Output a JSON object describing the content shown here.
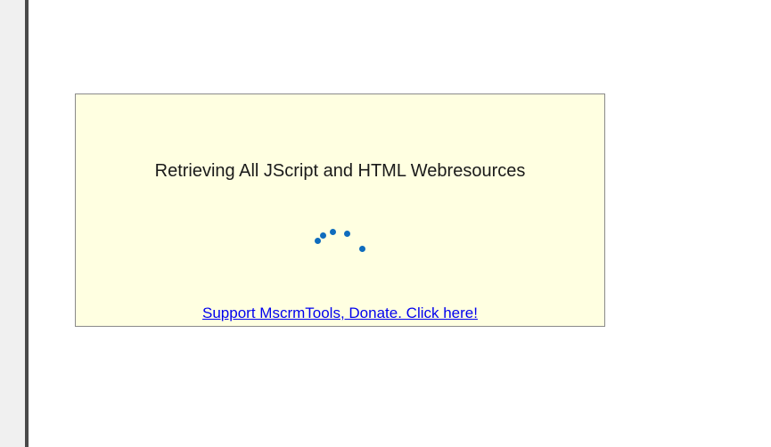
{
  "loading": {
    "message": "Retrieving All JScript and HTML Webresources",
    "link_text": "Support MscrmTools, Donate. Click here!"
  },
  "spinner": {
    "icon": "loading-spinner-icon",
    "color": "#0f6cbd"
  },
  "colors": {
    "panel_background": "#ffffe1",
    "link": "#0000ee"
  }
}
